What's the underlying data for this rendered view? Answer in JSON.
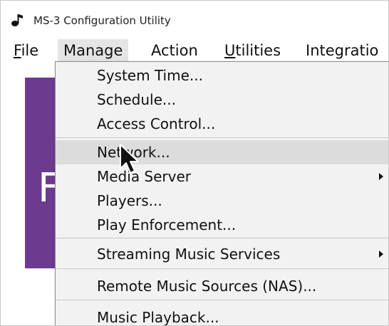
{
  "window": {
    "title": "MS-3 Configuration Utility",
    "icon": "music-note-icon"
  },
  "menubar": {
    "items": [
      {
        "label": "File",
        "mnemonic": "F",
        "rest": "ile"
      },
      {
        "label": "Manage"
      },
      {
        "label": "Action"
      },
      {
        "label": "Utilities",
        "mnemonic": "U",
        "rest": "tilities"
      },
      {
        "label": "Integratio"
      }
    ],
    "active": "Manage"
  },
  "background": {
    "letter": "F",
    "accent_color": "#6c3a8f"
  },
  "manage_menu": {
    "items": [
      {
        "label": "System Time..."
      },
      {
        "label": "Schedule..."
      },
      {
        "label": "Access Control..."
      },
      {
        "label": "Network...",
        "hovered": true
      },
      {
        "label": "Media Server",
        "submenu": true
      },
      {
        "label": "Players..."
      },
      {
        "label": "Play Enforcement..."
      },
      {
        "label": "Streaming Music Services",
        "submenu": true
      },
      {
        "label": "Remote Music Sources (NAS)..."
      },
      {
        "label": "Music Playback..."
      }
    ]
  },
  "cursor": "arrow-cursor-icon"
}
